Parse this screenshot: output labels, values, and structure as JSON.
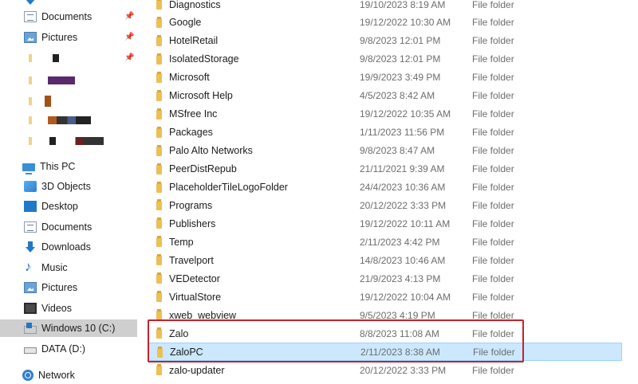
{
  "navigation": {
    "quick_access_items": [
      {
        "label": "Documents",
        "icon": "documents-icon",
        "pinned": true
      },
      {
        "label": "Pictures",
        "icon": "pictures-icon",
        "pinned": true
      }
    ],
    "this_pc": {
      "label": "This PC",
      "children": [
        {
          "label": "3D Objects",
          "icon": "3d-objects-icon"
        },
        {
          "label": "Desktop",
          "icon": "desktop-icon"
        },
        {
          "label": "Documents",
          "icon": "documents-icon"
        },
        {
          "label": "Downloads",
          "icon": "downloads-icon"
        },
        {
          "label": "Music",
          "icon": "music-icon"
        },
        {
          "label": "Pictures",
          "icon": "pictures-icon"
        },
        {
          "label": "Videos",
          "icon": "videos-icon"
        },
        {
          "label": "Windows 10 (C:)",
          "icon": "windows-drive-icon",
          "selected": true
        },
        {
          "label": "DATA (D:)",
          "icon": "drive-icon"
        }
      ]
    },
    "network": {
      "label": "Network",
      "icon": "network-icon"
    }
  },
  "files": [
    {
      "name": "Diagnostics",
      "date": "19/10/2023 8:19 AM",
      "type": "File folder"
    },
    {
      "name": "Google",
      "date": "19/12/2022 10:30 AM",
      "type": "File folder"
    },
    {
      "name": "HotelRetail",
      "date": "9/8/2023 12:01 PM",
      "type": "File folder"
    },
    {
      "name": "IsolatedStorage",
      "date": "9/8/2023 12:01 PM",
      "type": "File folder"
    },
    {
      "name": "Microsoft",
      "date": "19/9/2023 3:49 PM",
      "type": "File folder"
    },
    {
      "name": "Microsoft Help",
      "date": "4/5/2023 8:42 AM",
      "type": "File folder"
    },
    {
      "name": "MSfree Inc",
      "date": "19/12/2022 10:35 AM",
      "type": "File folder"
    },
    {
      "name": "Packages",
      "date": "1/11/2023 11:56 PM",
      "type": "File folder"
    },
    {
      "name": "Palo Alto Networks",
      "date": "9/8/2023 8:47 AM",
      "type": "File folder"
    },
    {
      "name": "PeerDistRepub",
      "date": "21/11/2021 9:39 AM",
      "type": "File folder"
    },
    {
      "name": "PlaceholderTileLogoFolder",
      "date": "24/4/2023 10:36 AM",
      "type": "File folder"
    },
    {
      "name": "Programs",
      "date": "20/12/2022 3:33 PM",
      "type": "File folder"
    },
    {
      "name": "Publishers",
      "date": "19/12/2022 10:11 AM",
      "type": "File folder"
    },
    {
      "name": "Temp",
      "date": "2/11/2023 4:42 PM",
      "type": "File folder"
    },
    {
      "name": "Travelport",
      "date": "14/8/2023 10:46 AM",
      "type": "File folder"
    },
    {
      "name": "VEDetector",
      "date": "21/9/2023 4:13 PM",
      "type": "File folder"
    },
    {
      "name": "VirtualStore",
      "date": "19/12/2022 10:04 AM",
      "type": "File folder"
    },
    {
      "name": "xweb_webview",
      "date": "9/5/2023 4:19 PM",
      "type": "File folder"
    },
    {
      "name": "Zalo",
      "date": "8/8/2023 11:08 AM",
      "type": "File folder"
    },
    {
      "name": "ZaloPC",
      "date": "2/11/2023 8:38 AM",
      "type": "File folder",
      "selected": true
    },
    {
      "name": "zalo-updater",
      "date": "20/12/2022 3:33 PM",
      "type": "File folder"
    }
  ],
  "colors": {
    "selection_background": "#cce8ff",
    "annotation_border": "#c4222a",
    "nav_selected_background": "#cfcfcf"
  }
}
